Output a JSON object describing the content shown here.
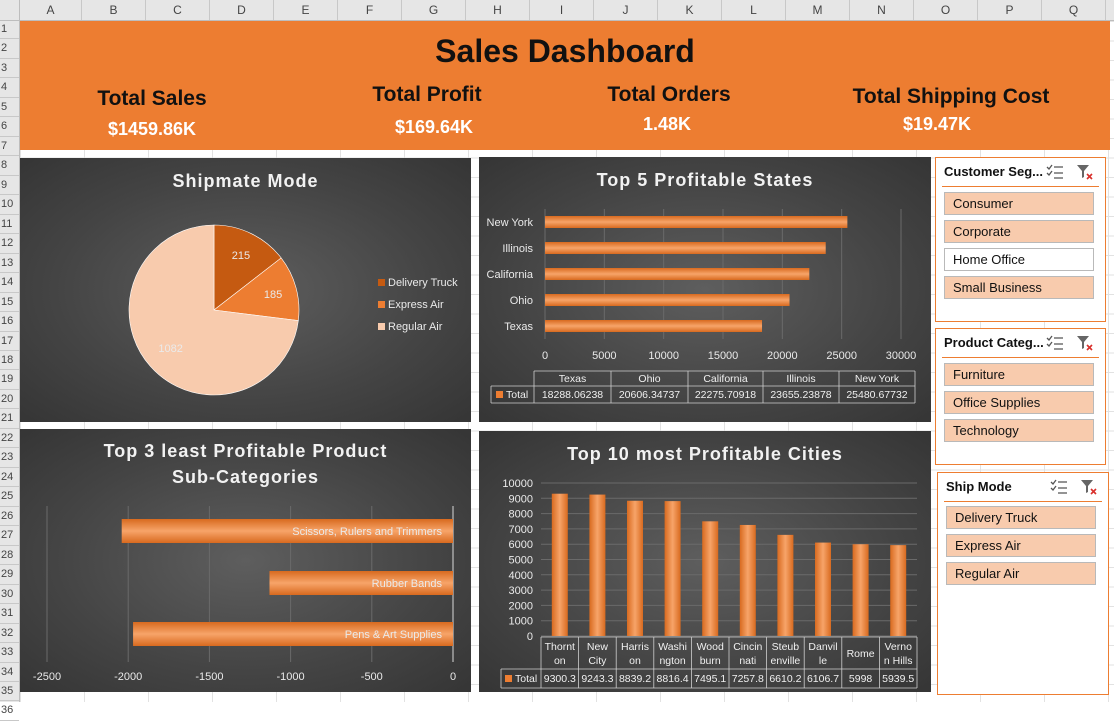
{
  "sheet": {
    "columns": [
      "A",
      "B",
      "C",
      "D",
      "E",
      "F",
      "G",
      "H",
      "I",
      "J",
      "K",
      "L",
      "M",
      "N",
      "O",
      "P",
      "Q"
    ],
    "rows": [
      "1",
      "2",
      "3",
      "4",
      "5",
      "6",
      "7",
      "8",
      "9",
      "10",
      "11",
      "12",
      "13",
      "14",
      "15",
      "16",
      "17",
      "18",
      "19",
      "20",
      "21",
      "22",
      "23",
      "24",
      "25",
      "26",
      "27",
      "28",
      "29",
      "30",
      "31",
      "32",
      "33",
      "34",
      "35",
      "36"
    ]
  },
  "banner": {
    "title": "Sales Dashboard",
    "kpis": [
      {
        "label": "Total Sales",
        "value": "$1459.86K"
      },
      {
        "label": "Total Profit",
        "value": "$169.64K"
      },
      {
        "label": "Total Orders",
        "value": "1.48K"
      },
      {
        "label": "Total Shipping Cost",
        "value": "$19.47K"
      }
    ],
    "color": "#ed7d31"
  },
  "charts": {
    "shipmode": {
      "title": "Shipmate Mode"
    },
    "states": {
      "title": "Top 5 Profitable States",
      "table_series": "Total"
    },
    "subcats": {
      "title_line1": "Top  3 least Profitable Product",
      "title_line2": "Sub-Categories"
    },
    "cities": {
      "title": "Top 10 most Profitable Cities",
      "table_series": "Total"
    }
  },
  "chart_data": [
    {
      "type": "pie",
      "title": "Shipmate Mode",
      "categories": [
        "Delivery Truck",
        "Express Air",
        "Regular Air"
      ],
      "values": [
        215,
        185,
        1082
      ],
      "colors": [
        "#c55a11",
        "#ed7d31",
        "#f8cbad"
      ],
      "legend": "right"
    },
    {
      "type": "bar",
      "orientation": "horizontal",
      "title": "Top 5 Profitable States",
      "categories": [
        "Texas",
        "Ohio",
        "California",
        "Illinois",
        "New York"
      ],
      "values": [
        18288.06238,
        20606.34737,
        22275.70918,
        23655.23878,
        25480.67732
      ],
      "value_labels": [
        "18288.06238",
        "20606.34737",
        "22275.70918",
        "23655.23878",
        "25480.67732"
      ],
      "series": [
        {
          "name": "Total"
        }
      ],
      "xlim": [
        0,
        30000
      ],
      "xticks": [
        "0",
        "5000",
        "10000",
        "15000",
        "20000",
        "25000",
        "30000"
      ],
      "grid": true
    },
    {
      "type": "bar",
      "orientation": "horizontal",
      "title": "Top  3 least Profitable Product Sub-Categories",
      "categories": [
        "Scissors, Rulers and Trimmers",
        "Rubber Bands",
        "Pens & Art Supplies"
      ],
      "values": [
        -2040,
        -1130,
        -1970
      ],
      "xlim": [
        -2500,
        0
      ],
      "xticks": [
        "-2500",
        "-2000",
        "-1500",
        "-1000",
        "-500",
        "0"
      ],
      "grid": true
    },
    {
      "type": "bar",
      "title": "Top 10 most Profitable Cities",
      "categories": [
        [
          "Thornt",
          "on"
        ],
        [
          "New",
          "City"
        ],
        [
          "Harris",
          "on"
        ],
        [
          "Washi",
          "ngton"
        ],
        [
          "Wood",
          "burn"
        ],
        [
          "Cincin",
          "nati"
        ],
        [
          "Steub",
          "enville"
        ],
        [
          "Danvil",
          "le"
        ],
        [
          "Rome"
        ],
        [
          "Verno",
          "n Hills"
        ]
      ],
      "values": [
        9300.3,
        9243.3,
        8839.2,
        8816.4,
        7495.1,
        7257.8,
        6610.2,
        6106.7,
        5998,
        5939.5
      ],
      "value_labels": [
        "9300.3",
        "9243.3",
        "8839.2",
        "8816.4",
        "7495.1",
        "7257.8",
        "6610.2",
        "6106.7",
        "5998",
        "5939.5"
      ],
      "series": [
        {
          "name": "Total"
        }
      ],
      "ylim": [
        0,
        10000
      ],
      "yticks": [
        "0",
        "1000",
        "2000",
        "3000",
        "4000",
        "5000",
        "6000",
        "7000",
        "8000",
        "9000",
        "10000"
      ],
      "grid": true
    }
  ],
  "slicers": {
    "segment": {
      "title": "Customer Seg...",
      "items": [
        {
          "label": "Consumer",
          "selected": true
        },
        {
          "label": "Corporate",
          "selected": true
        },
        {
          "label": "Home Office",
          "selected": false
        },
        {
          "label": "Small Business",
          "selected": true
        }
      ]
    },
    "category": {
      "title": "Product Categ...",
      "items": [
        {
          "label": "Furniture",
          "selected": true
        },
        {
          "label": "Office Supplies",
          "selected": true
        },
        {
          "label": "Technology",
          "selected": true
        }
      ]
    },
    "shipmode": {
      "title": "Ship Mode",
      "items": [
        {
          "label": "Delivery Truck",
          "selected": true
        },
        {
          "label": "Express Air",
          "selected": true
        },
        {
          "label": "Regular Air",
          "selected": true
        }
      ]
    },
    "icons": [
      "multi-select-icon",
      "clear-filter-icon"
    ]
  }
}
